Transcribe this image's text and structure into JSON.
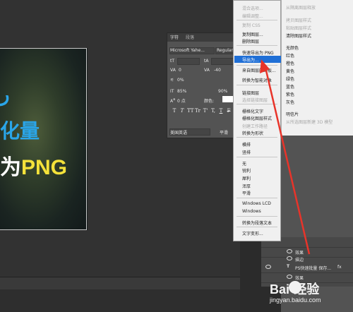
{
  "canvas": {
    "line1": "ر",
    "line2": "化量",
    "line3_white": "为",
    "line3_yellow": "PNG"
  },
  "character_panel": {
    "tab_character": "字符",
    "tab_paragraph": "段落",
    "font_family": "Microsoft Yahe...",
    "font_style": "Regular",
    "size_value": "",
    "leading_value": "",
    "kerning_value": "0",
    "tracking_value": "-40",
    "scale_v": "0%",
    "scale_h": "85%",
    "scale_h2": "90%",
    "baseline": "0 点",
    "color_label": "颜色:",
    "format_buttons": [
      "T",
      "T",
      "TT",
      "Tr",
      "T'",
      "T,",
      "T",
      "F"
    ],
    "language": "美国英语",
    "aa_mode": "平滑"
  },
  "context_menu": {
    "items": [
      {
        "label": "混合选项...",
        "disabled": true
      },
      {
        "label": "编辑调整...",
        "disabled": true
      },
      {
        "label": "复制 CSS",
        "disabled": true
      },
      {
        "label": "复制图层...",
        "disabled": false
      },
      {
        "label": "删除图层",
        "disabled": false
      },
      {
        "label": "快速导出为 PNG",
        "disabled": false
      },
      {
        "label": "导出为...",
        "disabled": false,
        "highlight": true
      },
      {
        "label": "来自图层的画板...",
        "disabled": false
      },
      {
        "label": "转换为智能对象",
        "disabled": false
      },
      {
        "label": "链接图层",
        "disabled": false
      },
      {
        "label": "选择链接图层",
        "disabled": true
      },
      {
        "label": "栅格化文字",
        "disabled": false
      },
      {
        "label": "栅格化图层样式",
        "disabled": false
      },
      {
        "label": "创建工作路径",
        "disabled": true
      },
      {
        "label": "转换为形状",
        "disabled": false
      },
      {
        "label": "横排",
        "disabled": false
      },
      {
        "label": "竖排",
        "disabled": false
      },
      {
        "label": "无",
        "disabled": false
      },
      {
        "label": "锐利",
        "disabled": false
      },
      {
        "label": "犀利",
        "disabled": false
      },
      {
        "label": "浑厚",
        "disabled": false
      },
      {
        "label": "平滑",
        "disabled": false
      },
      {
        "label": "Windows LCD",
        "disabled": false
      },
      {
        "label": "Windows",
        "disabled": false
      },
      {
        "label": "转换为段落文本",
        "disabled": false
      },
      {
        "label": "文字变形...",
        "disabled": false
      }
    ]
  },
  "style_menu": {
    "items": [
      {
        "label": "从隔离图层释放",
        "disabled": true
      },
      {
        "label": "拷贝图层样式",
        "disabled": true
      },
      {
        "label": "粘贴图层样式",
        "disabled": true
      },
      {
        "label": "清除图层样式",
        "disabled": false
      },
      {
        "label": "无颜色",
        "disabled": false
      },
      {
        "label": "红色",
        "disabled": false
      },
      {
        "label": "橙色",
        "disabled": false
      },
      {
        "label": "黄色",
        "disabled": false
      },
      {
        "label": "绿色",
        "disabled": false
      },
      {
        "label": "蓝色",
        "disabled": false
      },
      {
        "label": "紫色",
        "disabled": false
      },
      {
        "label": "灰色",
        "disabled": false
      },
      {
        "label": "明信片",
        "disabled": false
      },
      {
        "label": "从所选图层新建 3D 模型",
        "disabled": true
      }
    ]
  },
  "layers": {
    "rows": [
      {
        "label": "效果"
      },
      {
        "label": "描边"
      },
      {
        "label": "PS快速批量 保存..."
      },
      {
        "label": "效果"
      }
    ],
    "fx_label": "fx"
  },
  "watermark": {
    "brand": "Bai•经验",
    "url": "jingyan.baidu.com"
  },
  "colors": {
    "highlight": "#1f6fd6",
    "arrow": "#e8342a",
    "title_blue": "#2aa5e8",
    "title_yellow": "#f5e23a"
  }
}
